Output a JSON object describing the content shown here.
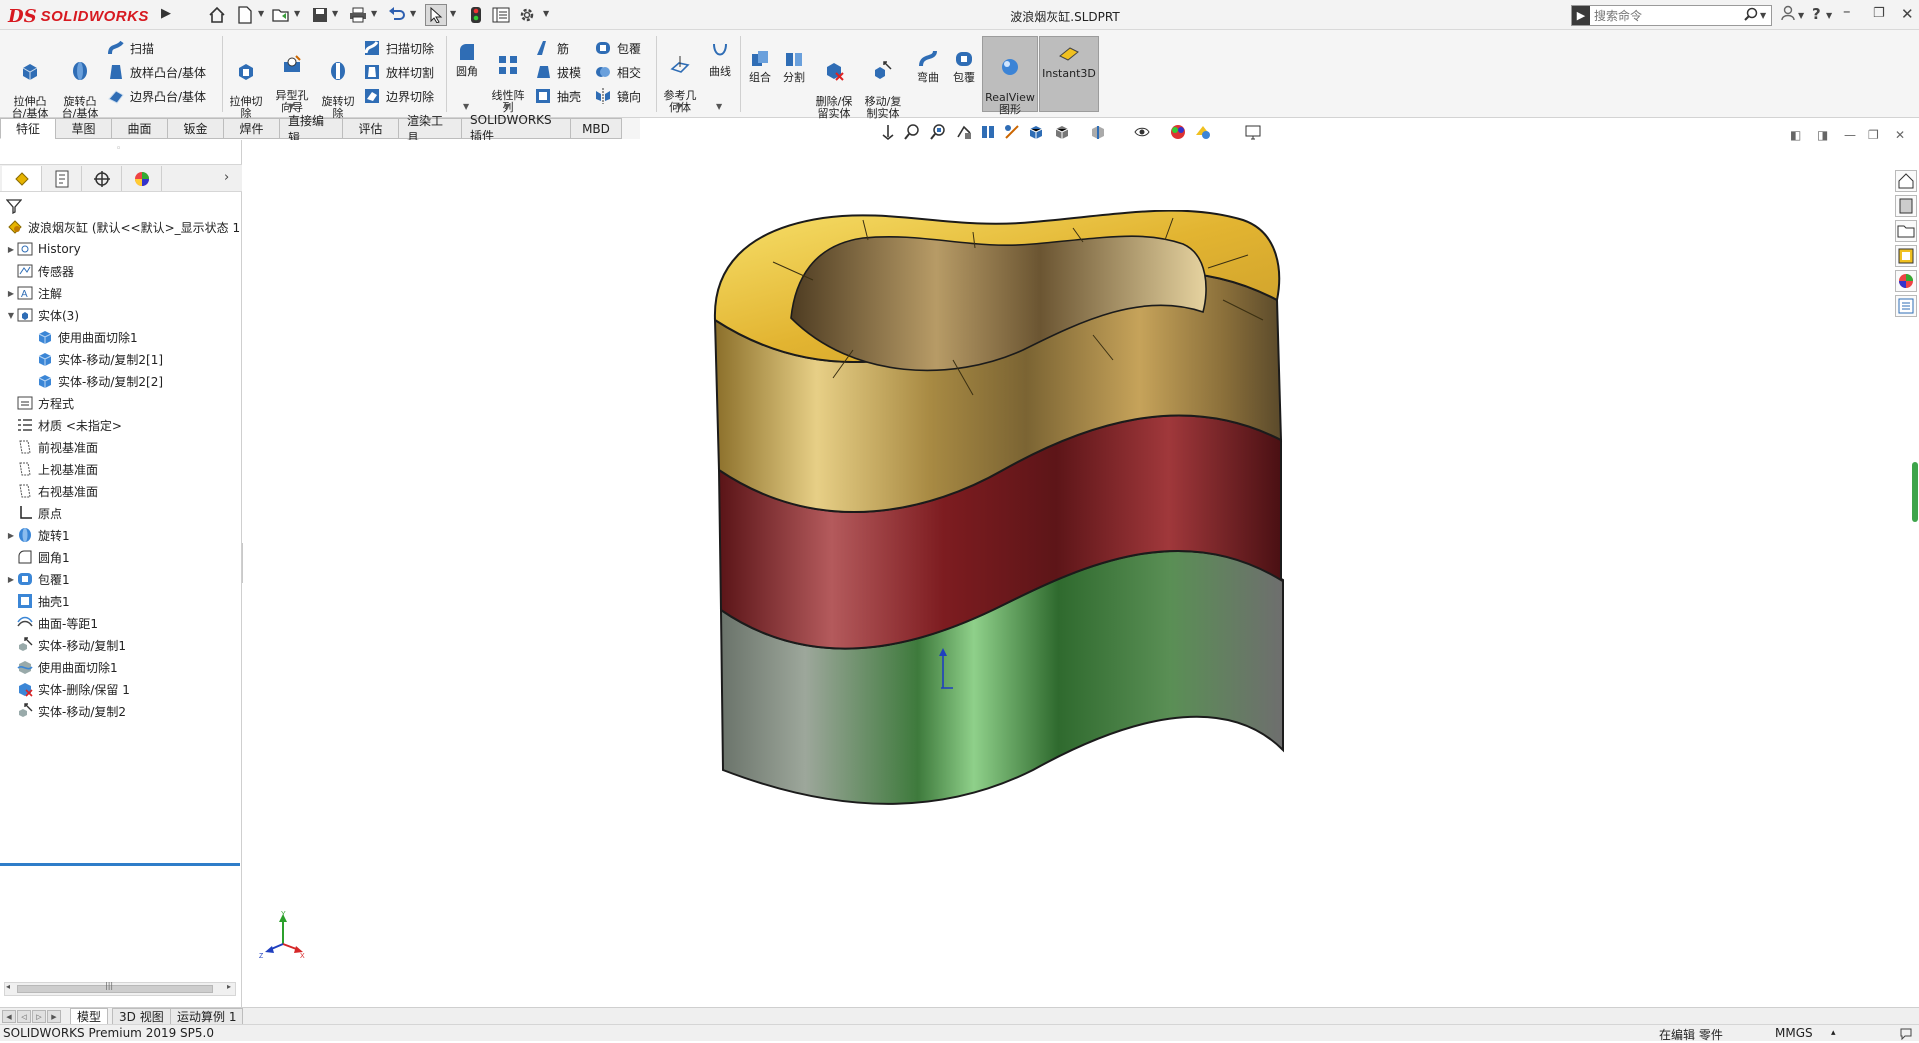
{
  "app": {
    "brand_ds": "DS",
    "brand_name": "SOLIDWORKS"
  },
  "window": {
    "title": "波浪烟灰缸.SLDPRT"
  },
  "search": {
    "placeholder": "搜索命令"
  },
  "commands": {
    "extrude_boss": "拉伸凸\n台/基体",
    "revolve_boss": "旋转凸\n台/基体",
    "sweep": "扫描",
    "loft_boss": "放样凸台/基体",
    "boundary_boss": "边界凸台/基体",
    "extrude_cut": "拉伸切\n除",
    "hole_wizard": "异型孔\n向导",
    "revolve_cut": "旋转切\n除",
    "swept_cut": "扫描切除",
    "lofted_cut": "放样切割",
    "boundary_cut": "边界切除",
    "fillet": "圆角",
    "linear_pattern": "线性阵\n列",
    "rib": "筋",
    "draft": "拔模",
    "shell": "抽壳",
    "wrap": "包覆",
    "intersect": "相交",
    "mirror": "镜向",
    "reference_geometry": "参考几\n何体",
    "curves": "曲线",
    "combine": "组合",
    "split": "分割",
    "delete_keep_body": "删除/保\n留实体",
    "move_copy_body": "移动/复\n制实体",
    "flex": "弯曲",
    "wrap2": "包覆",
    "realview": "RealView\n图形",
    "instant3d": "Instant3D"
  },
  "tabs": [
    {
      "label": "特征",
      "active": true
    },
    {
      "label": "草图"
    },
    {
      "label": "曲面"
    },
    {
      "label": "钣金"
    },
    {
      "label": "焊件"
    },
    {
      "label": "直接编辑"
    },
    {
      "label": "评估"
    },
    {
      "label": "渲染工具"
    },
    {
      "label": "SOLIDWORKS 插件"
    },
    {
      "label": "MBD"
    }
  ],
  "tree": {
    "root": "波浪烟灰缸 (默认<<默认>_显示状态 1",
    "items": [
      {
        "label": "History",
        "icon": "history-icon",
        "expander": "right"
      },
      {
        "label": "传感器",
        "icon": "sensor-icon",
        "expander": ""
      },
      {
        "label": "注解",
        "icon": "annotation-icon",
        "expander": "right"
      },
      {
        "label": "实体(3)",
        "icon": "solid-bodies-folder-icon",
        "expander": "down"
      },
      {
        "label": "使用曲面切除1",
        "icon": "solid-body-icon",
        "expander": "",
        "indent": 1
      },
      {
        "label": "实体-移动/复制2[1]",
        "icon": "solid-body-icon",
        "expander": "",
        "indent": 1
      },
      {
        "label": "实体-移动/复制2[2]",
        "icon": "solid-body-icon",
        "expander": "",
        "indent": 1
      },
      {
        "label": "方程式",
        "icon": "equation-icon",
        "expander": ""
      },
      {
        "label": "材质 <未指定>",
        "icon": "material-icon",
        "expander": ""
      },
      {
        "label": "前视基准面",
        "icon": "plane-icon",
        "expander": ""
      },
      {
        "label": "上视基准面",
        "icon": "plane-icon",
        "expander": ""
      },
      {
        "label": "右视基准面",
        "icon": "plane-icon",
        "expander": ""
      },
      {
        "label": "原点",
        "icon": "origin-icon",
        "expander": ""
      },
      {
        "label": "旋转1",
        "icon": "revolve-icon",
        "expander": "right"
      },
      {
        "label": "圆角1",
        "icon": "fillet-icon",
        "expander": ""
      },
      {
        "label": "包覆1",
        "icon": "wrap-icon",
        "expander": "right"
      },
      {
        "label": "抽壳1",
        "icon": "shell-icon",
        "expander": ""
      },
      {
        "label": "曲面-等距1",
        "icon": "offset-surface-icon",
        "expander": ""
      },
      {
        "label": "实体-移动/复制1",
        "icon": "move-copy-icon",
        "expander": ""
      },
      {
        "label": "使用曲面切除1",
        "icon": "surface-cut-icon",
        "expander": ""
      },
      {
        "label": "实体-删除/保留 1",
        "icon": "delete-body-icon",
        "expander": ""
      },
      {
        "label": "实体-移动/复制2",
        "icon": "move-copy-icon",
        "expander": ""
      }
    ]
  },
  "bottom_tabs": [
    {
      "label": "模型",
      "active": true
    },
    {
      "label": "3D 视图"
    },
    {
      "label": "运动算例 1"
    }
  ],
  "status": {
    "product": "SOLIDWORKS Premium 2019 SP5.0",
    "editing": "在编辑 零件",
    "units": "MMGS",
    "units_caret": "▴"
  },
  "triad": {
    "x": "X",
    "y": "Y",
    "z": "Z"
  },
  "colors": {
    "gold": "#c9a640",
    "red": "#8e2226",
    "green": "#4f8b4a",
    "rollback": "#2f7dc9"
  }
}
